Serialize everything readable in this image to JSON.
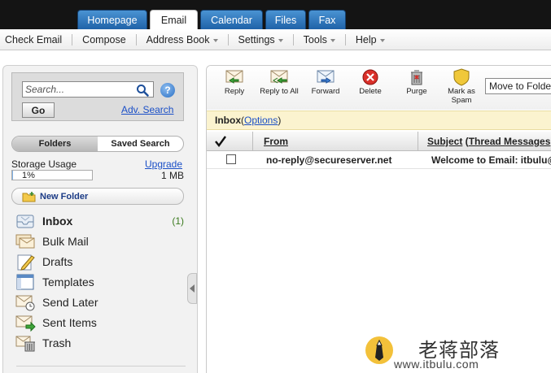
{
  "tabs": [
    {
      "label": "Homepage",
      "active": false
    },
    {
      "label": "Email",
      "active": true
    },
    {
      "label": "Calendar",
      "active": false
    },
    {
      "label": "Files",
      "active": false
    },
    {
      "label": "Fax",
      "active": false
    }
  ],
  "menubar": {
    "check_email": "Check Email",
    "compose": "Compose",
    "address_book": "Address Book",
    "settings": "Settings",
    "tools": "Tools",
    "help": "Help"
  },
  "search": {
    "placeholder": "Search...",
    "go_label": "Go",
    "adv_search_label": "Adv. Search",
    "help_glyph": "?"
  },
  "folder_tabs": {
    "folders": "Folders",
    "saved_search": "Saved Search"
  },
  "storage": {
    "label": "Storage Usage",
    "upgrade": "Upgrade",
    "percent_text": "1%",
    "percent_value": 1,
    "size": "1 MB"
  },
  "new_folder_label": "New Folder",
  "folders": [
    {
      "name": "Inbox",
      "count": "(1)",
      "icon": "inbox-icon",
      "bold": true
    },
    {
      "name": "Bulk Mail",
      "count": "",
      "icon": "bulk-mail-icon",
      "bold": false
    },
    {
      "name": "Drafts",
      "count": "",
      "icon": "drafts-icon",
      "bold": false
    },
    {
      "name": "Templates",
      "count": "",
      "icon": "templates-icon",
      "bold": false
    },
    {
      "name": "Send Later",
      "count": "",
      "icon": "send-later-icon",
      "bold": false
    },
    {
      "name": "Sent Items",
      "count": "",
      "icon": "sent-items-icon",
      "bold": false
    },
    {
      "name": "Trash",
      "count": "",
      "icon": "trash-icon",
      "bold": false
    }
  ],
  "toolbar": {
    "reply": "Reply",
    "reply_all": "Reply to All",
    "forward": "Forward",
    "delete": "Delete",
    "purge": "Purge",
    "mark_spam": "Mark as Spam",
    "move_to_folder": "Move to Folder"
  },
  "inbox_bar": {
    "title": "Inbox",
    "open_paren": " (",
    "options": "Options",
    "close_paren": ")"
  },
  "table": {
    "headers": {
      "from": "From",
      "subject": "Subject",
      "subject_open": " (",
      "thread_messages": "Thread Messages"
    },
    "rows": [
      {
        "from": "no-reply@secureserver.net",
        "subject": "Welcome to Email: itbulu@"
      }
    ]
  },
  "watermark": {
    "text_cn": "老蒋部落",
    "url": "www.itbulu.com"
  },
  "colors": {
    "tab_blue": "#2f79c1",
    "link_blue": "#1a4fc7",
    "inbox_bar_bg": "#fbf3cf",
    "count_green": "#3a7a1e",
    "delete_red": "#d9302a"
  }
}
